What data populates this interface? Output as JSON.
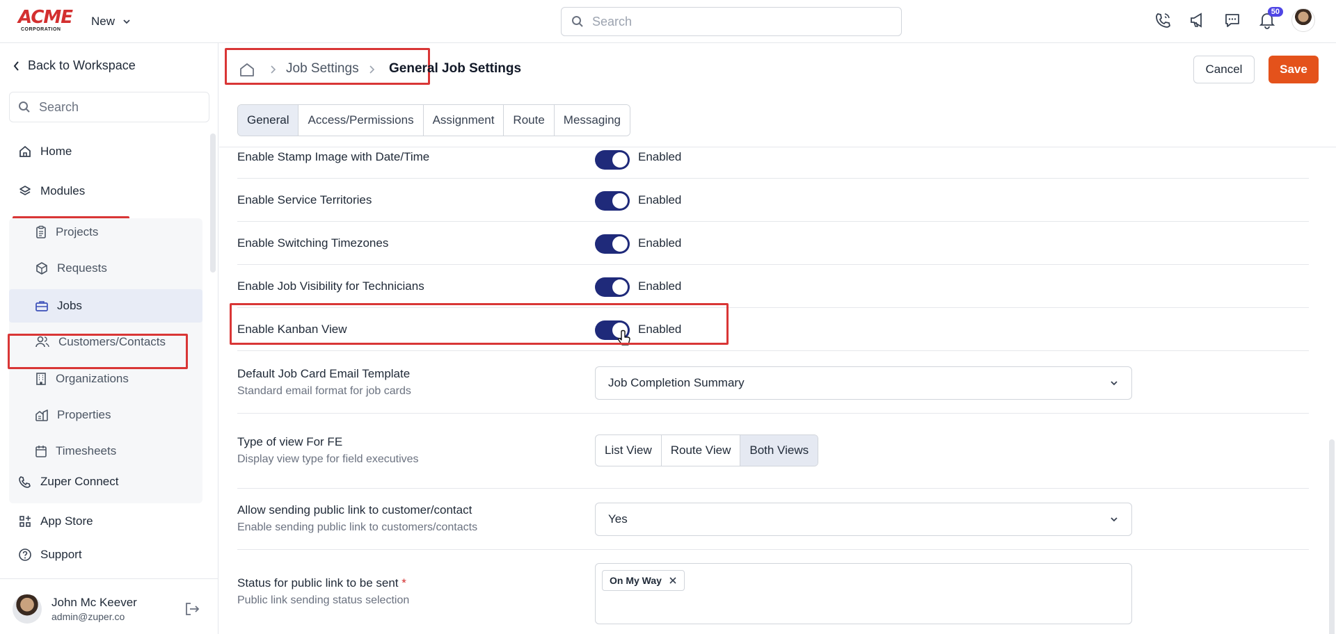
{
  "topbar": {
    "logo_text": "ACME",
    "logo_sub": "CORPORATION",
    "new_label": "New",
    "search_placeholder": "Search",
    "notification_count": "50"
  },
  "sidebar": {
    "back_label": "Back to Workspace",
    "search_placeholder": "Search",
    "home": "Home",
    "modules": "Modules",
    "module_items": [
      "Projects",
      "Requests",
      "Jobs",
      "Customers/Contacts",
      "Organizations",
      "Properties",
      "Timesheets"
    ],
    "zuper_connect": "Zuper Connect",
    "app_store": "App Store",
    "support": "Support",
    "user_name": "John Mc Keever",
    "user_email": "admin@zuper.co"
  },
  "header": {
    "breadcrumb_1": "Job Settings",
    "breadcrumb_2": "General Job Settings",
    "cancel": "Cancel",
    "save": "Save",
    "tabs": [
      "General",
      "Access/Permissions",
      "Assignment",
      "Route",
      "Messaging"
    ],
    "active_tab": "General"
  },
  "settings": {
    "row0_label": "Enable Stamp Image with Date/Time",
    "row1_label": "Enable Service Territories",
    "row2_label": "Enable Switching Timezones",
    "row3_label": "Enable Job Visibility for Technicians",
    "row4_label": "Enable Kanban View",
    "enabled_text": "Enabled",
    "email_template_label": "Default Job Card Email Template",
    "email_template_desc": "Standard email format for job cards",
    "email_template_value": "Job Completion Summary",
    "view_type_label": "Type of view For FE",
    "view_type_desc": "Display view type for field executives",
    "view_options": [
      "List View",
      "Route View",
      "Both Views"
    ],
    "view_selected": "Both Views",
    "public_link_label": "Allow sending public link to customer/contact",
    "public_link_desc": "Enable sending public link to customers/contacts",
    "public_link_value": "Yes",
    "status_label": "Status for public link to be sent",
    "status_required": "*",
    "status_desc": "Public link sending status selection",
    "status_chip": "On My Way"
  },
  "colors": {
    "accent": "#1f2a7a",
    "save": "#e4521b",
    "highlight": "#d93636",
    "logo": "#d32f2f"
  }
}
